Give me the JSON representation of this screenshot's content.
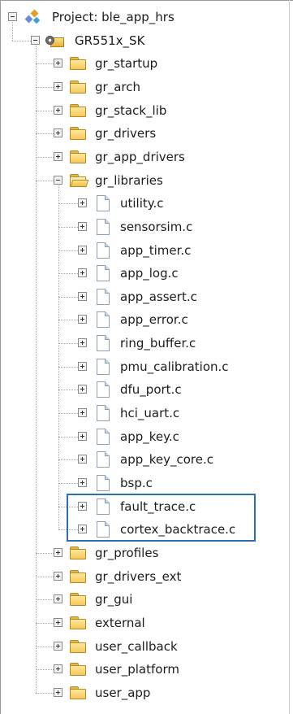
{
  "project": {
    "label": "Project: ble_app_hrs",
    "icon": "project-icon"
  },
  "target": {
    "label": "GR551x_SK",
    "icon": "target-icon"
  },
  "groups_before": [
    {
      "label": "gr_startup",
      "icon": "folder-icon"
    },
    {
      "label": "gr_arch",
      "icon": "folder-icon"
    },
    {
      "label": "gr_stack_lib",
      "icon": "folder-icon"
    },
    {
      "label": "gr_drivers",
      "icon": "folder-icon"
    },
    {
      "label": "gr_app_drivers",
      "icon": "folder-icon"
    }
  ],
  "libraries": {
    "label": "gr_libraries",
    "icon": "open-folder-icon",
    "files": [
      {
        "label": "utility.c"
      },
      {
        "label": "sensorsim.c"
      },
      {
        "label": "app_timer.c"
      },
      {
        "label": "app_log.c"
      },
      {
        "label": "app_assert.c"
      },
      {
        "label": "app_error.c"
      },
      {
        "label": "ring_buffer.c"
      },
      {
        "label": "pmu_calibration.c"
      },
      {
        "label": "dfu_port.c"
      },
      {
        "label": "hci_uart.c"
      },
      {
        "label": "app_key.c"
      },
      {
        "label": "app_key_core.c"
      },
      {
        "label": "bsp.c"
      },
      {
        "label": "fault_trace.c"
      },
      {
        "label": "cortex_backtrace.c"
      }
    ]
  },
  "groups_after": [
    {
      "label": "gr_profiles",
      "icon": "folder-icon"
    },
    {
      "label": "gr_drivers_ext",
      "icon": "folder-icon"
    },
    {
      "label": "gr_gui",
      "icon": "folder-icon"
    },
    {
      "label": "external",
      "icon": "folder-icon"
    },
    {
      "label": "user_callback",
      "icon": "folder-icon"
    },
    {
      "label": "user_platform",
      "icon": "folder-icon"
    },
    {
      "label": "user_app",
      "icon": "folder-icon"
    }
  ],
  "colors": {
    "highlight_box": "#2c6fb3",
    "folder": "#f3c95b"
  }
}
